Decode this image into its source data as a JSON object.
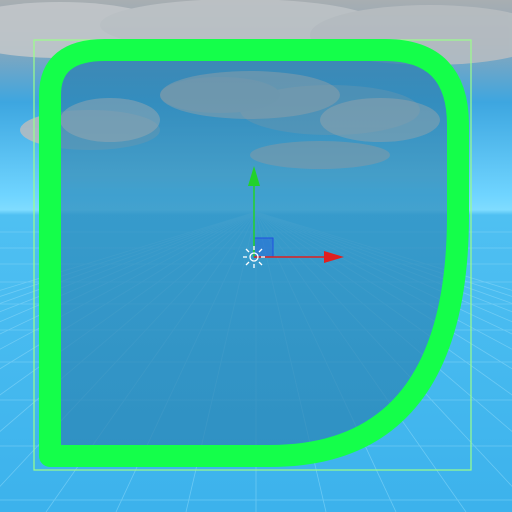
{
  "scene": {
    "sky_top_color": "#9aa3a8",
    "sky_mid_color": "#3b9fd8",
    "horizon_color": "#7fdcff",
    "ground_color": "#45b7f0",
    "grid_line_color": "#7dd2f7",
    "cloud_color": "#c9cdd0"
  },
  "selected_shape": {
    "type": "rounded-quad-sprite",
    "outline_color": "#14ff4a",
    "fill_color": "#1a6f9c",
    "fill_opacity": 0.55,
    "bounding_box_color": "#9bff8a"
  },
  "transform_gizmo": {
    "x_axis_color": "#e02020",
    "y_axis_color": "#22d22a",
    "plane_handle_color": "#2050e0",
    "pivot_icon": "sun-pivot-icon"
  }
}
